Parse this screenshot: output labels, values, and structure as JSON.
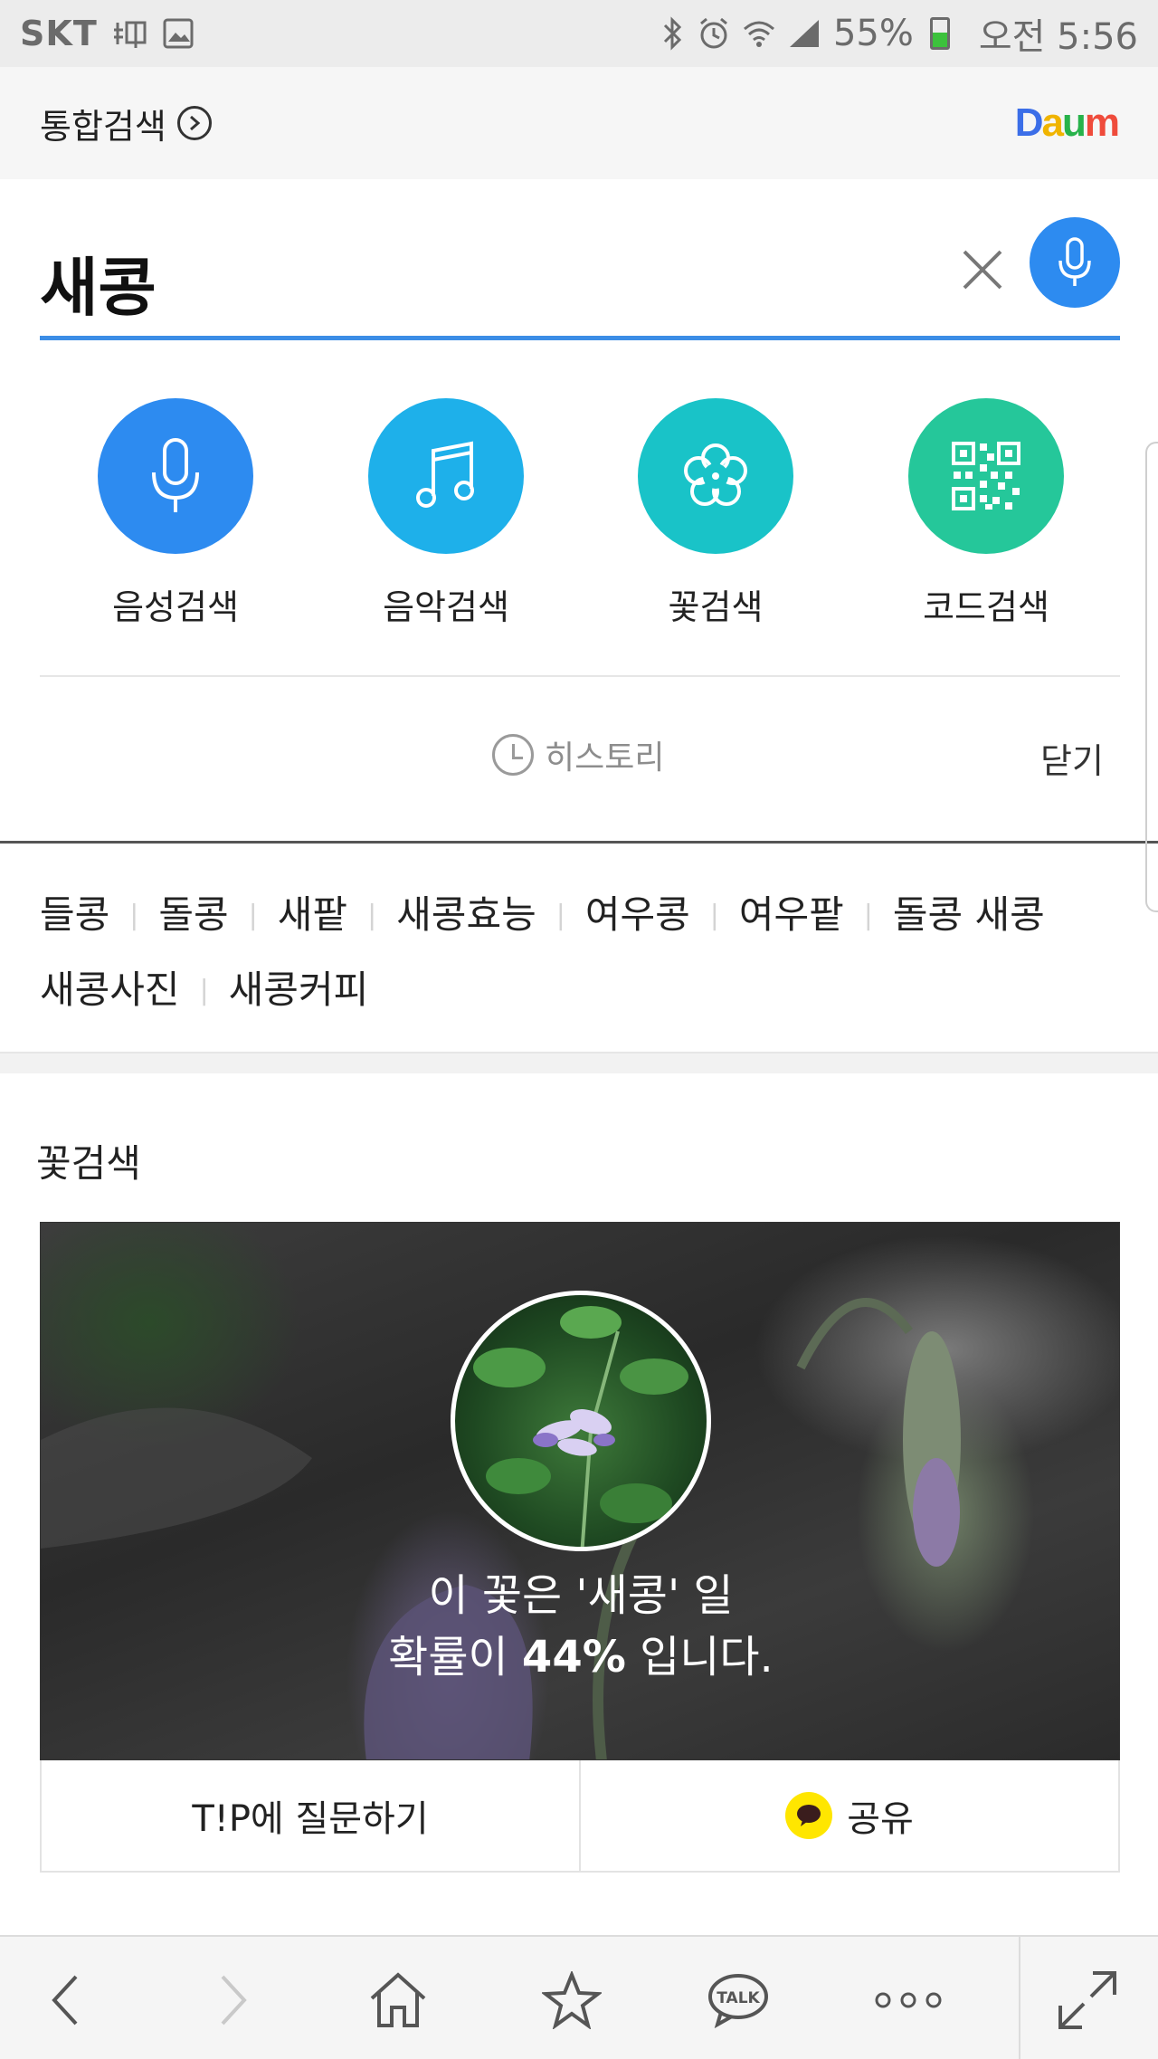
{
  "status_bar": {
    "carrier": "SKT",
    "battery": "55%",
    "time": "오전 5:56",
    "icons": [
      "notification-icon",
      "gallery-icon",
      "bluetooth-icon",
      "alarm-icon",
      "wifi-icon",
      "signal-icon",
      "battery-icon"
    ]
  },
  "header": {
    "unified_search": "통합검색",
    "logo": "Daum"
  },
  "search": {
    "query": "새콩"
  },
  "quick_search": {
    "items": [
      {
        "label": "음성검색",
        "icon": "microphone-icon",
        "color": "#2d8bf0"
      },
      {
        "label": "음악검색",
        "icon": "music-note-icon",
        "color": "#1eb0ea"
      },
      {
        "label": "꽃검색",
        "icon": "flower-icon",
        "color": "#19c3c8"
      },
      {
        "label": "코드검색",
        "icon": "qr-code-icon",
        "color": "#25c79a"
      }
    ]
  },
  "history": {
    "label": "히스토리",
    "close": "닫기"
  },
  "related": {
    "keywords": [
      "들콩",
      "돌콩",
      "새팥",
      "새콩효능",
      "여우콩",
      "여우팥",
      "돌콩 새콩",
      "새콩사진",
      "새콩커피"
    ]
  },
  "flower_section": {
    "title": "꽃검색",
    "result_line1": "이 꽃은 '새콩' 일",
    "result_line2_prefix": "확률이 ",
    "result_percent": "44%",
    "result_line2_suffix": " 입니다.",
    "ask_button": "T!P에 질문하기",
    "share_button": "공유"
  },
  "bottom_bar": {
    "talk_label": "TALK"
  }
}
